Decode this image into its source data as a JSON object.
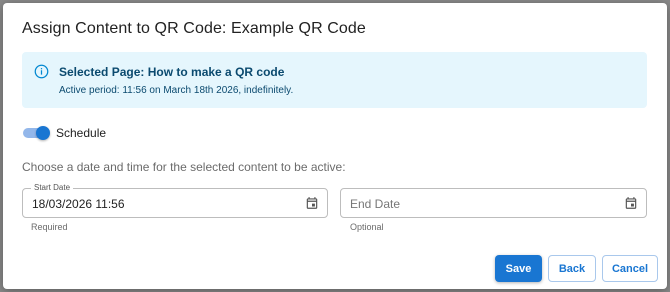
{
  "dialog": {
    "title": "Assign Content to QR Code: Example QR Code"
  },
  "alert": {
    "icon": "info-icon",
    "title": "Selected Page: How to make a QR code",
    "body": "Active period: 11:56 on March 18th 2026, indefinitely.",
    "background": "#e5f6fd",
    "text_color": "#0b4a6f"
  },
  "schedule": {
    "label": "Schedule",
    "enabled": true
  },
  "instruction": "Choose a date and time for the selected content to be active:",
  "start_date": {
    "label": "Start Date",
    "value": "18/03/2026 11:56",
    "helper": "Required",
    "icon": "calendar-icon"
  },
  "end_date": {
    "placeholder": "End Date",
    "value": "",
    "helper": "Optional",
    "icon": "calendar-icon"
  },
  "actions": {
    "save": "Save",
    "back": "Back",
    "cancel": "Cancel"
  },
  "colors": {
    "primary": "#1976d2"
  }
}
